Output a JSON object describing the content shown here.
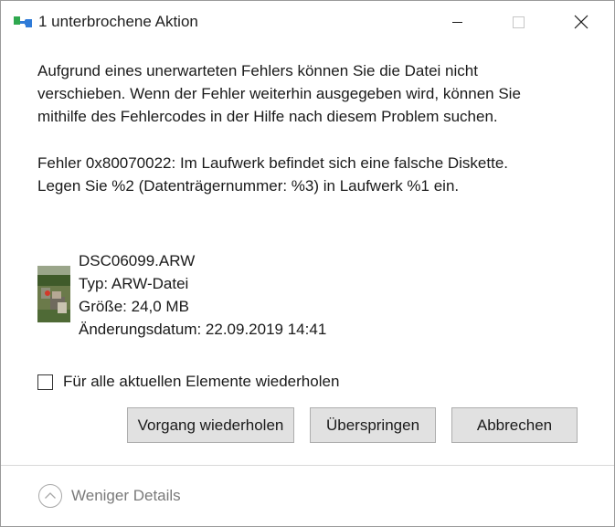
{
  "window": {
    "title": "1 unterbrochene Aktion",
    "icon": "file-move-icon"
  },
  "message": {
    "paragraph1_line1": "Aufgrund eines unerwarteten Fehlers können Sie die Datei nicht",
    "paragraph1_line2": "verschieben. Wenn der Fehler weiterhin ausgegeben wird, können Sie",
    "paragraph1_line3": "mithilfe des Fehlercodes in der Hilfe nach diesem Problem suchen.",
    "paragraph2_line1": "Fehler 0x80070022: Im Laufwerk befindet sich eine falsche Diskette.",
    "paragraph2_line2": "Legen Sie %2 (Datenträgernummer: %3) in Laufwerk %1 ein."
  },
  "file": {
    "name": "DSC06099.ARW",
    "type": "Typ: ARW-Datei",
    "size": "Größe: 24,0 MB",
    "modified": "Änderungsdatum: 22.09.2019 14:41"
  },
  "checkbox": {
    "label": "Für alle aktuellen Elemente wiederholen",
    "checked": false
  },
  "buttons": {
    "retry": "Vorgang wiederholen",
    "skip": "Überspringen",
    "cancel": "Abbrechen"
  },
  "footer": {
    "details_label": "Weniger Details"
  },
  "colors": {
    "button_bg": "#e1e1e1",
    "button_border": "#adadad",
    "details_text": "#7a7a7a",
    "icon_blue": "#2f7bd8",
    "icon_green": "#2fa84f"
  }
}
